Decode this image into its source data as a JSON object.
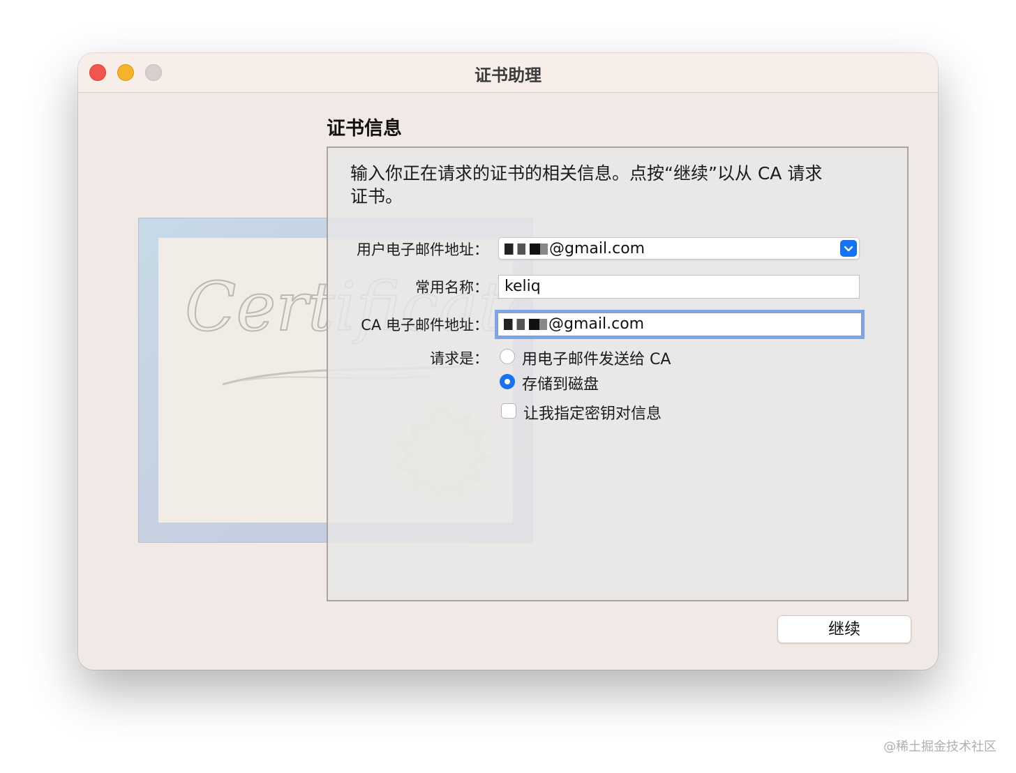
{
  "window": {
    "title": "证书助理"
  },
  "artwork": {
    "word": "Certificate"
  },
  "content": {
    "section_title": "证书信息",
    "intro_line1": "输入你正在请求的证书的相关信息。点按“继续”以从 CA 请求",
    "intro_line2": "证书。"
  },
  "form": {
    "email_label": "用户电子邮件地址：",
    "email_value": "@gmail.com",
    "common_name_label": "常用名称：",
    "common_name_value": "keliq",
    "ca_email_label": "CA 电子邮件地址：",
    "ca_email_value": "@gmail.com",
    "request_label": "请求是：",
    "options": [
      {
        "label": "用电子邮件发送给 CA",
        "selected": false
      },
      {
        "label": "存储到磁盘",
        "selected": true
      }
    ],
    "checkbox_label": "让我指定密钥对信息",
    "checkbox_checked": false
  },
  "buttons": {
    "continue_label": "继续"
  },
  "watermark": "@稀土掘金技术社区",
  "colors": {
    "accent": "#1672f0",
    "focus_ring": "#7aa6ee",
    "window_bg": "#f1e9e5"
  }
}
